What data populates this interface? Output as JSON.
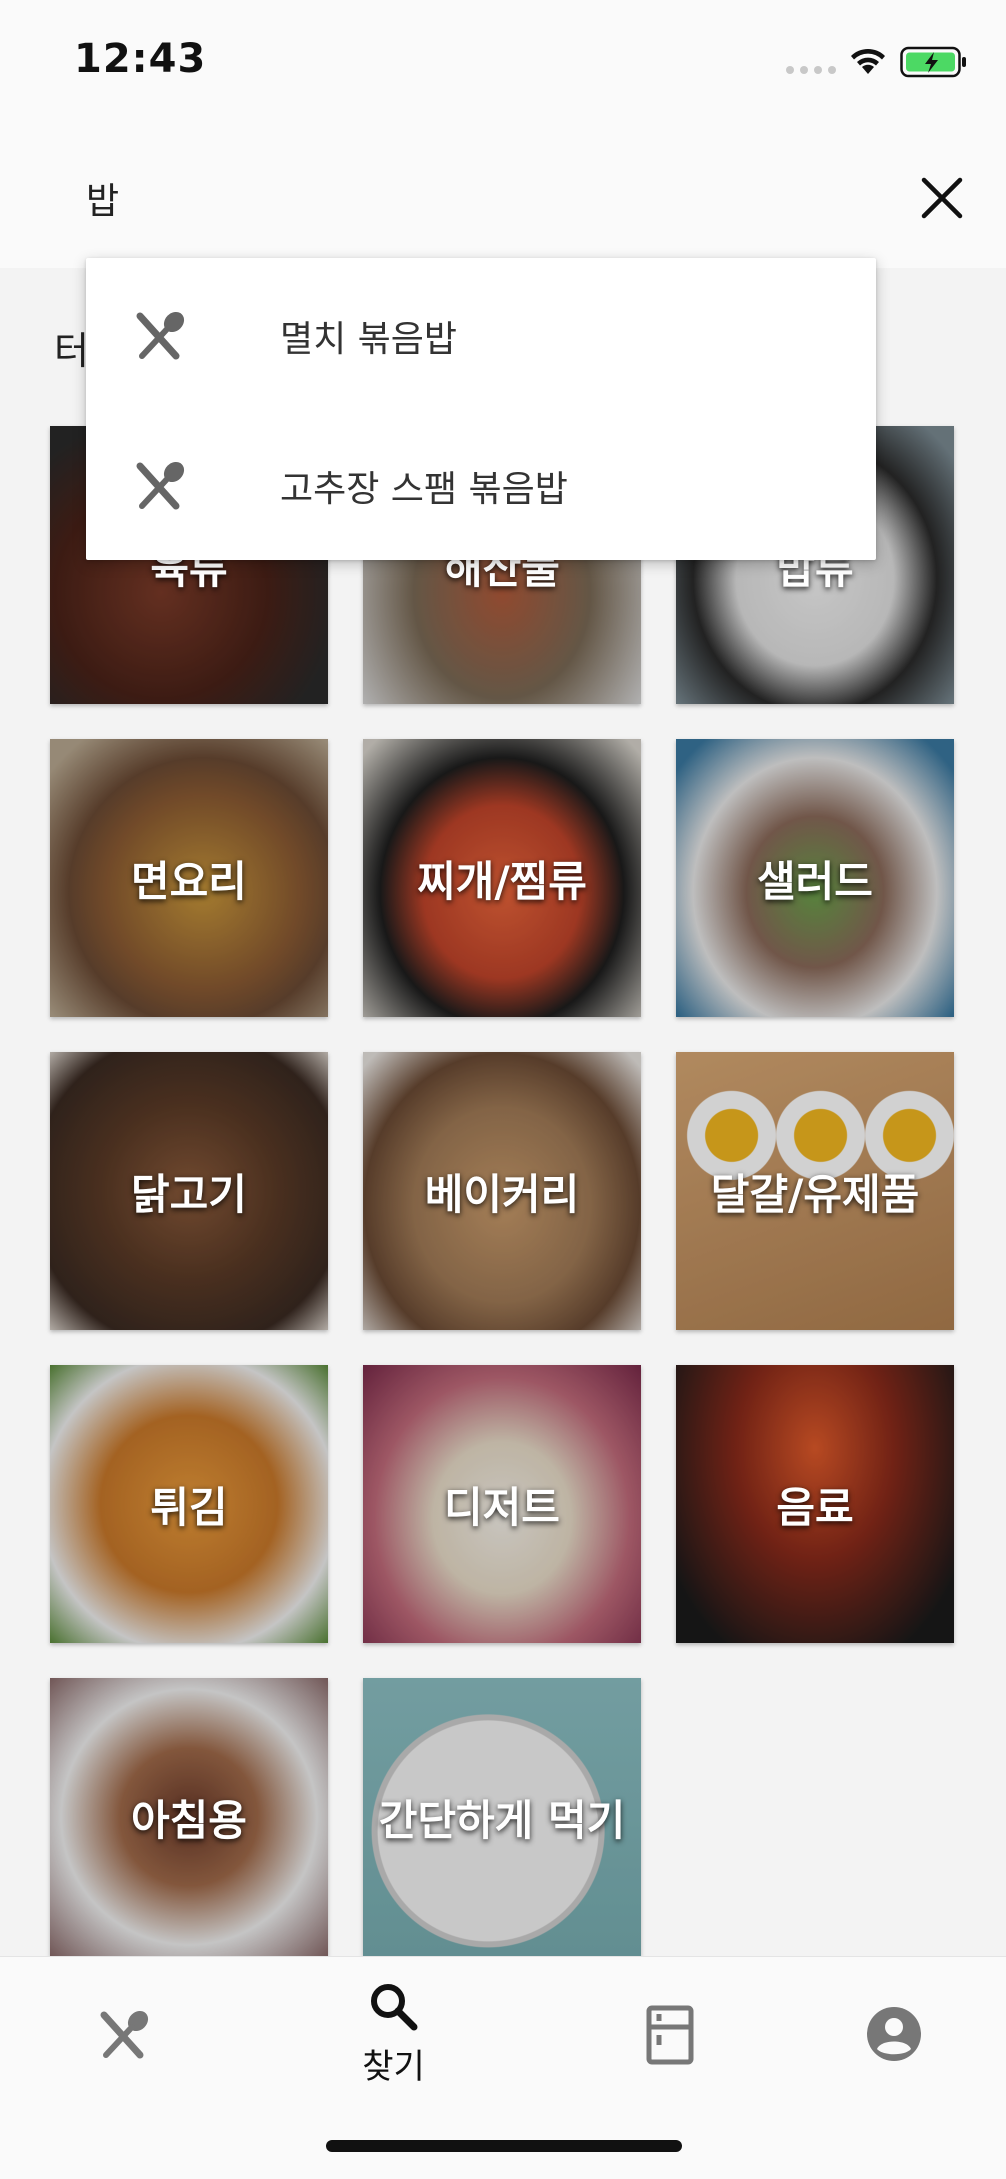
{
  "status_bar": {
    "time": "12:43",
    "icons": [
      "signal-dots-icon",
      "wifi-icon",
      "battery-charging-icon"
    ],
    "battery_color": "#4cd964"
  },
  "search": {
    "value": "밥",
    "clear_icon": "close-icon"
  },
  "section_title": "터",
  "suggestions": [
    {
      "icon": "utensils-icon",
      "text": "멸치 볶음밥"
    },
    {
      "icon": "utensils-icon",
      "text": "고추장 스팸 볶음밥"
    }
  ],
  "categories": [
    {
      "label": "육류",
      "image": "grilled-steak",
      "color": "#5a3a2c"
    },
    {
      "label": "해산물",
      "image": "grilled-seafood",
      "color": "#7a6a56"
    },
    {
      "label": "밥류",
      "image": "rice-pot",
      "color": "#6a6a6a"
    },
    {
      "label": "면요리",
      "image": "noodle-bowl",
      "color": "#8a6a48"
    },
    {
      "label": "찌개/찜류",
      "image": "stew-pot",
      "color": "#a04a2a"
    },
    {
      "label": "샐러드",
      "image": "salad-plate",
      "color": "#5a8a6a"
    },
    {
      "label": "닭고기",
      "image": "grilled-chicken",
      "color": "#6a4a32"
    },
    {
      "label": "베이커리",
      "image": "cookies",
      "color": "#9a7a5a"
    },
    {
      "label": "달걀/유제품",
      "image": "boiled-eggs",
      "color": "#c09a6a"
    },
    {
      "label": "튀김",
      "image": "fried-shrimp",
      "color": "#c88a3a"
    },
    {
      "label": "디저트",
      "image": "cheesecake",
      "color": "#a0607a"
    },
    {
      "label": "음료",
      "image": "cocktails",
      "color": "#5a2a1a"
    },
    {
      "label": "아침용",
      "image": "breakfast-plate",
      "color": "#8a5a4a"
    },
    {
      "label": "간단하게 먹기",
      "image": "clock",
      "color": "#86b8bc"
    }
  ],
  "bottom_nav": [
    {
      "icon": "utensils-icon",
      "label": "",
      "active": false
    },
    {
      "icon": "search-icon",
      "label": "찾기",
      "active": true
    },
    {
      "icon": "fridge-icon",
      "label": "",
      "active": false
    },
    {
      "icon": "account-icon",
      "label": "",
      "active": false
    }
  ]
}
